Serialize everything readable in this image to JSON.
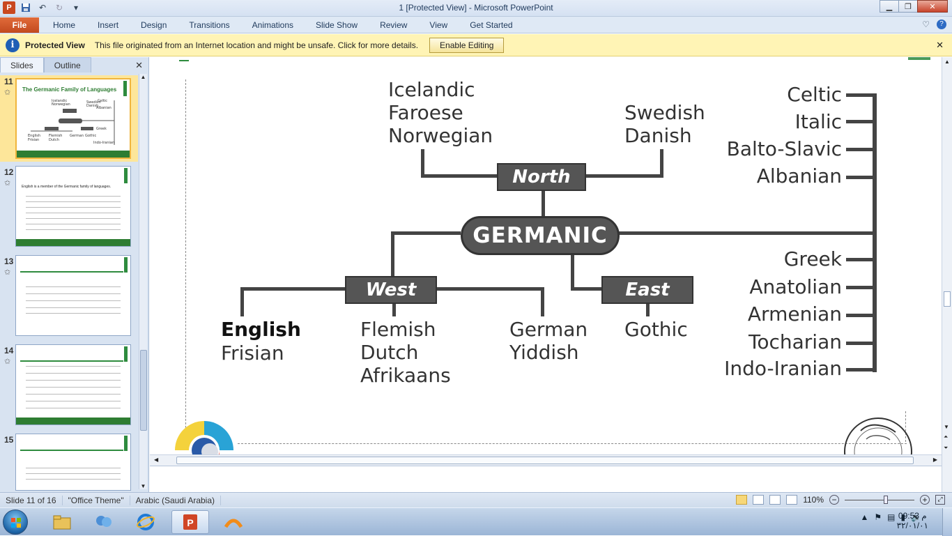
{
  "window": {
    "title": "1 [Protected View] - Microsoft PowerPoint",
    "minimize": "▭",
    "maximize": "❐",
    "close": "✕"
  },
  "ribbon": {
    "file": "File",
    "tabs": [
      "Home",
      "Insert",
      "Design",
      "Transitions",
      "Animations",
      "Slide Show",
      "Review",
      "View",
      "Get Started"
    ]
  },
  "protected_view": {
    "title": "Protected View",
    "message": "This file originated from an Internet location and might be unsafe. Click for more details.",
    "enable_button": "Enable Editing"
  },
  "left_pane": {
    "tab_slides": "Slides",
    "tab_outline": "Outline",
    "slides": [
      {
        "number": "11",
        "title": "The Germanic Family of Languages",
        "selected": true
      },
      {
        "number": "12",
        "title": "English is a member of the Germanic family of languages."
      },
      {
        "number": "13",
        "title": ""
      },
      {
        "number": "14",
        "title": ""
      },
      {
        "number": "15",
        "title": ""
      }
    ]
  },
  "diagram": {
    "center": "GERMANIC",
    "north_label": "North",
    "west_label": "West",
    "east_label": "East",
    "north_left": [
      "Icelandic",
      "Faroese",
      "Norwegian"
    ],
    "north_right": [
      "Swedish",
      "Danish"
    ],
    "west_1": [
      "English",
      "Frisian"
    ],
    "west_2": [
      "Flemish",
      "Dutch",
      "Afrikaans"
    ],
    "west_3": [
      "German",
      "Yiddish"
    ],
    "east_1": [
      "Gothic"
    ],
    "other_top": [
      "Celtic",
      "Italic",
      "Balto-Slavic",
      "Albanian"
    ],
    "other_bottom": [
      "Greek",
      "Anatolian",
      "Armenian",
      "Tocharian",
      "Indo-Iranian"
    ]
  },
  "status": {
    "slide": "Slide 11 of 16",
    "theme": "\"Office Theme\"",
    "language": "Arabic (Saudi Arabia)",
    "zoom": "110%"
  },
  "taskbar": {
    "time": "09:53 م",
    "date": "٣٢/٠١/٠١"
  }
}
